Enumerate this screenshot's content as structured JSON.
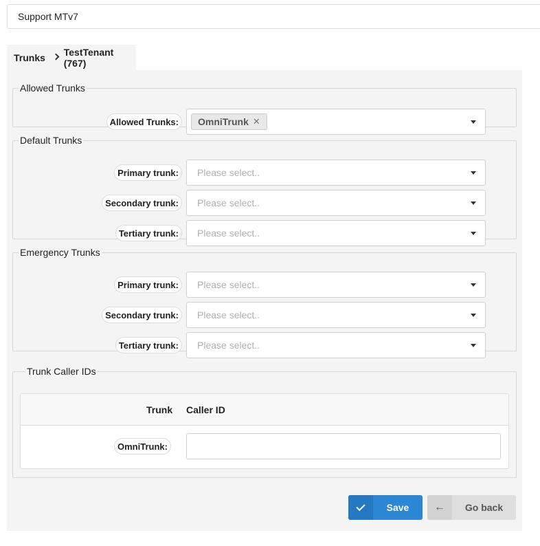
{
  "header": {
    "title": "Support MTv7"
  },
  "breadcrumb": {
    "root": "Trunks",
    "current": "TestTenant (767)"
  },
  "allowed": {
    "legend": "Allowed Trunks",
    "label": "Allowed Trunks:",
    "chip": "OmniTrunk",
    "chip_remove": "✕"
  },
  "default_trunks": {
    "legend": "Default Trunks",
    "primary_label": "Primary trunk:",
    "secondary_label": "Secondary trunk:",
    "tertiary_label": "Tertiary trunk:",
    "placeholder": "Please select.."
  },
  "emergency_trunks": {
    "legend": "Emergency Trunks",
    "primary_label": "Primary trunk:",
    "secondary_label": "Secondary trunk:",
    "tertiary_label": "Tertiary trunk:",
    "placeholder": "Please select.."
  },
  "caller_ids": {
    "legend": "Trunk Caller IDs",
    "col_trunk": "Trunk",
    "col_caller_id": "Caller ID",
    "rows": [
      {
        "trunk": "OmniTrunk:",
        "caller_id": ""
      }
    ]
  },
  "actions": {
    "save": "Save",
    "back": "Go back"
  },
  "colors": {
    "primary": "#2b86d3",
    "secondary": "#dedede",
    "panel": "#f4f4f4"
  }
}
